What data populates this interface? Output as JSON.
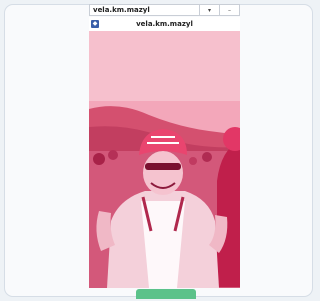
{
  "window": {
    "tab_title": "vela.km.mazyl",
    "dropdown_icon": "chevron-down-icon",
    "close_icon": "close-icon"
  },
  "app": {
    "title": "vela.km.mazyl",
    "logo_icon": "app-logo-icon"
  },
  "photo": {
    "subject": "cyclist portrait",
    "tint_color": "#e84a78"
  },
  "cta": {
    "color": "#5cc28a"
  }
}
